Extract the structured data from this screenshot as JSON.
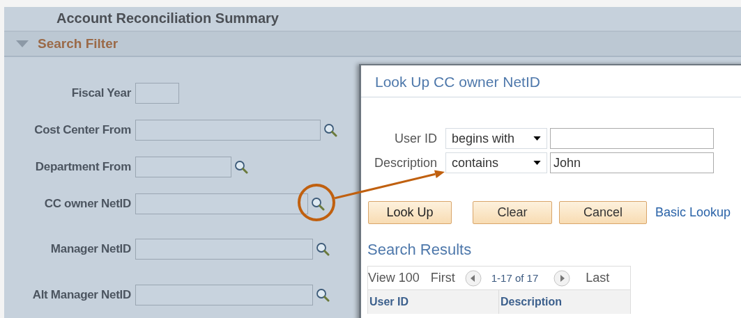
{
  "page": {
    "title": "Account Reconciliation Summary"
  },
  "section": {
    "title": "Search Filter",
    "expanded": true
  },
  "fields": [
    {
      "label": "Fiscal Year",
      "lookup": false
    },
    {
      "label": "Cost Center From",
      "lookup": true,
      "highlighted": false
    },
    {
      "label": "Department From",
      "lookup": true,
      "highlighted": false
    },
    {
      "label": "CC owner NetID",
      "lookup": true,
      "highlighted": true
    },
    {
      "label": "Manager NetID",
      "lookup": true,
      "highlighted": false
    },
    {
      "label": "Alt Manager NetID",
      "lookup": true,
      "highlighted": false
    }
  ],
  "dialog": {
    "title": "Look Up CC owner NetID",
    "criteria": [
      {
        "label": "User ID",
        "operator": "begins with"
      },
      {
        "label": "Description",
        "operator": "contains",
        "value": "John"
      }
    ],
    "buttons": [
      {
        "label": "Look Up",
        "kind": "primary"
      },
      {
        "label": "Clear",
        "kind": "normal"
      },
      {
        "label": "Cancel",
        "kind": "normal"
      }
    ],
    "link": "Basic Lookup",
    "results": {
      "title": "Search Results",
      "view": "View 100",
      "first": "First",
      "range": "1-17 of 17",
      "last": "Last",
      "columns": [
        "User ID",
        "Description"
      ]
    }
  }
}
